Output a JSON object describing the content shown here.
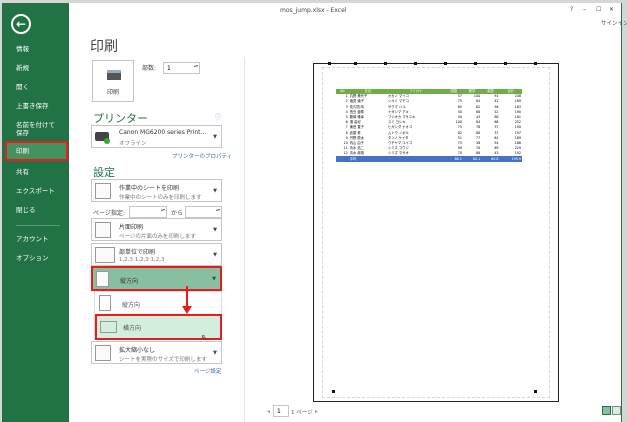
{
  "window": {
    "title": "mos_jump.xlsx - Excel",
    "help": "?",
    "minimize": "–",
    "maximize": "☐",
    "close": "✕",
    "signin": "サインイン"
  },
  "sidebar": {
    "back": "←",
    "items": [
      "情報",
      "新規",
      "開く",
      "上書き保存",
      "名前を付けて\n保存",
      "印刷",
      "共有",
      "エクスポート",
      "閉じる",
      "アカウント",
      "オプション"
    ],
    "selected": "印刷"
  },
  "print": {
    "title": "印刷",
    "button": "印刷",
    "copies_label": "部数:",
    "copies": "1"
  },
  "printer": {
    "heading": "プリンター",
    "name": "Canon MG6200 series Print…",
    "status": "オフライン",
    "properties": "プリンターのプロパティ",
    "info": "ⓘ"
  },
  "settings": {
    "heading": "設定",
    "what": {
      "title": "作業中のシートを印刷",
      "desc": "作業中のシートのみを印刷します"
    },
    "pages_label": "ページ指定:",
    "to_label": "から",
    "pages_from": "",
    "pages_to": "",
    "sides": {
      "title": "片面印刷",
      "desc": "ページの片面のみを印刷します"
    },
    "collate": {
      "title": "部単位で印刷",
      "desc": "1,2,3    1,2,3    1,2,3"
    },
    "orientation": {
      "title": "縦方向",
      "options": [
        "縦方向",
        "横方向"
      ],
      "highlighted": "横方向"
    },
    "scaling": {
      "title": "拡大縮小なし",
      "desc": "シートを実際のサイズで印刷します"
    },
    "page_setup": "ページ設定"
  },
  "preview": {
    "headers": [
      "No",
      "氏名",
      "フリガナ",
      "国語",
      "数学",
      "英語",
      "合計"
    ],
    "rows": [
      [
        "1",
        "丸野 美代子",
        "オカノ マイコ",
        "57",
        "100",
        "91",
        "248"
      ],
      [
        "2",
        "塩見 倫子",
        "シオミ マチコ",
        "75",
        "84",
        "42",
        "189"
      ],
      [
        "3",
        "佐久間 晴",
        "サクマ ハル",
        "65",
        "62",
        "56",
        "183"
      ],
      [
        "4",
        "長島 亜希",
        "ナガシマ アキ",
        "50",
        "88",
        "52",
        "190"
      ],
      [
        "5",
        "藤岡 雅幸",
        "フジオカ マサユキ",
        "50",
        "43",
        "88",
        "181"
      ],
      [
        "6",
        "澄 善紀",
        "スミ ヨシキ",
        "100",
        "84",
        "68",
        "252"
      ],
      [
        "7",
        "東田 直子",
        "ヒガシダ ナオコ",
        "75",
        "78",
        "37",
        "190"
      ],
      [
        "8",
        "武藤 昇",
        "ムトウ ノボル",
        "82",
        "88",
        "37",
        "197"
      ],
      [
        "9",
        "丹野 慶太",
        "タンノ ケイタ",
        "51",
        "77",
        "61",
        "189"
      ],
      [
        "10",
        "内山 由子",
        "ウチヤマ ユイコ",
        "75",
        "38",
        "54",
        "186"
      ],
      [
        "11",
        "清水 浩二",
        "シミズ コウジ",
        "90",
        "70",
        "69",
        "229"
      ],
      [
        "12",
        "清水 政雄",
        "シミズ マサオ",
        "70",
        "88",
        "43",
        "192"
      ]
    ],
    "average": [
      "",
      "平均",
      "",
      "66.1",
      "80.1",
      "60.8",
      "199.9"
    ],
    "page": "1",
    "page_total": "1 ページ"
  },
  "colors": {
    "accent": "#217346",
    "selected": "#44925f",
    "highlight": "#87c0a0",
    "red": "#e81c1c",
    "header_green": "#70ad47",
    "avg_blue": "#4472c4"
  }
}
